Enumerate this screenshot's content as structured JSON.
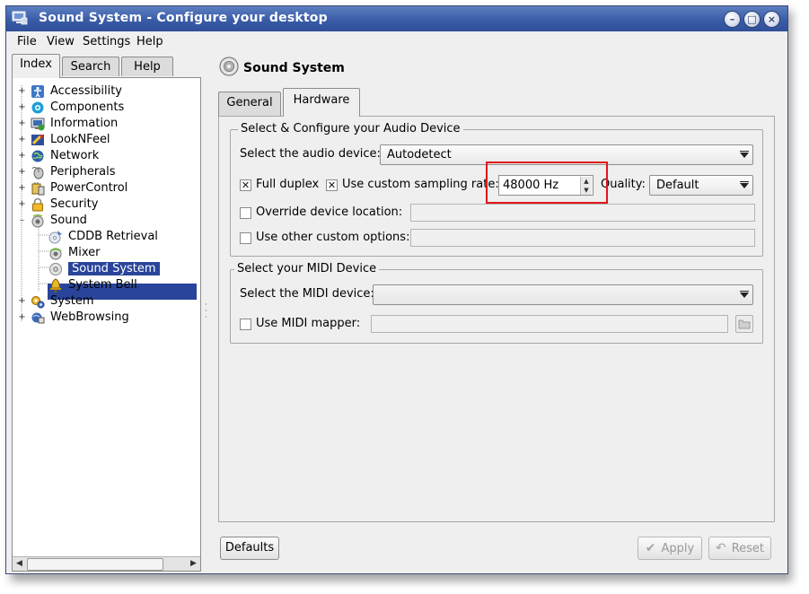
{
  "window": {
    "title": "Sound System - Configure your desktop",
    "buttons": [
      "minimize-icon",
      "maximize-icon",
      "close-icon"
    ]
  },
  "menu": {
    "file": "File",
    "view": "View",
    "settings": "Settings",
    "help": "Help"
  },
  "left_tabs": {
    "index": "Index",
    "search": "Search",
    "help": "Help"
  },
  "tree": {
    "accessibility": "Accessibility",
    "components": "Components",
    "information": "Information",
    "looknfeel": "LookNFeel",
    "network": "Network",
    "peripherals": "Peripherals",
    "powercontrol": "PowerControl",
    "security": "Security",
    "sound": "Sound",
    "cddb": "CDDB Retrieval",
    "mixer": "Mixer",
    "sound_system": "Sound System",
    "system_bell": "System Bell",
    "system": "System",
    "webbrowsing": "WebBrowsing"
  },
  "header": {
    "title": "Sound System"
  },
  "tabs": {
    "general": "General",
    "hardware": "Hardware"
  },
  "audio_group": {
    "title": "Select & Configure your Audio Device",
    "device_label": "Select the audio device:",
    "device_value": "Autodetect",
    "full_duplex": "Full duplex",
    "full_duplex_checked": true,
    "custom_rate": "Use custom sampling rate:",
    "custom_rate_checked": true,
    "rate_value": "48000 Hz",
    "quality_label": "Quality:",
    "quality_value": "Default",
    "override_location": "Override device location:",
    "override_checked": false,
    "other_options": "Use other custom options:",
    "other_checked": false
  },
  "midi_group": {
    "title": "Select your MIDI Device",
    "device_label": "Select the MIDI device:",
    "device_value": "",
    "mapper": "Use MIDI mapper:",
    "mapper_checked": false
  },
  "footer": {
    "defaults": "Defaults",
    "apply": "Apply",
    "reset": "Reset"
  },
  "colors": {
    "title_bar": "#3a5ca8",
    "selection": "#29449a",
    "highlight_box": "#e0161c"
  }
}
